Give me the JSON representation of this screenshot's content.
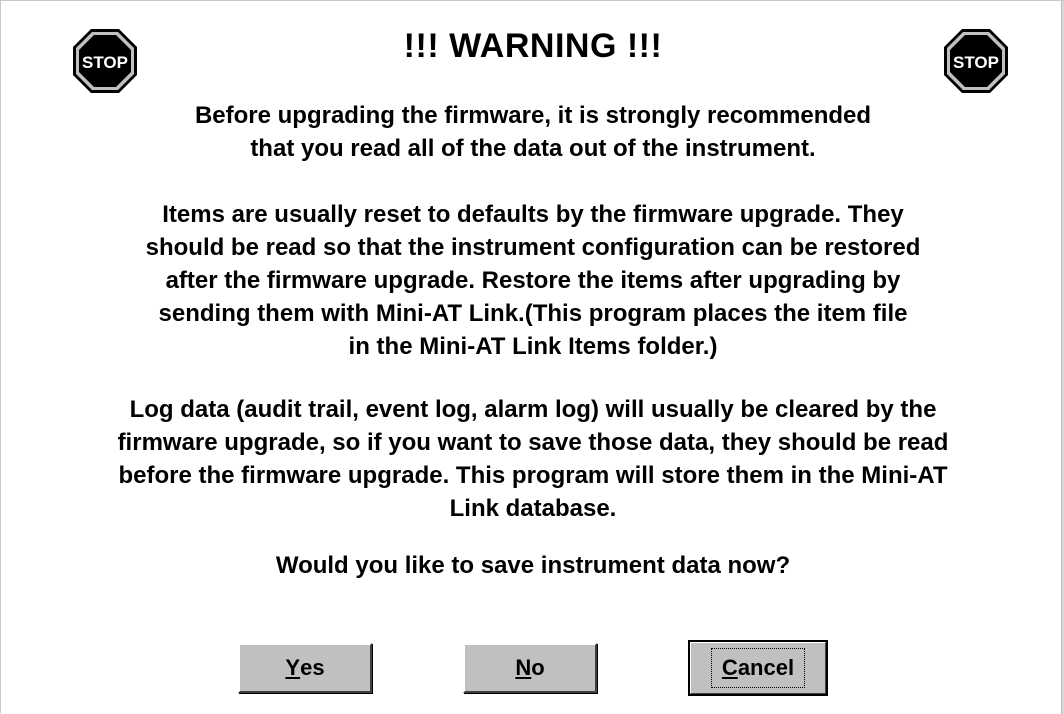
{
  "dialog": {
    "title": "!!! WARNING !!!",
    "icons": {
      "left": "stop-sign-icon",
      "right": "stop-sign-icon",
      "icon_text": "STOP",
      "icon_color": "#c0c0c0"
    },
    "paragraph1": [
      "Before upgrading the firmware, it is strongly recommended",
      "that you read all of the data out of the instrument."
    ],
    "paragraph2": [
      "Items are usually reset to defaults by the firmware upgrade. They",
      "should be read so that the instrument configuration can be restored",
      "after the firmware upgrade. Restore the items after upgrading by",
      "sending them with Mini-AT Link.(This program places the item file",
      "in the Mini-AT Link Items folder.)"
    ],
    "paragraph3": [
      "Log data (audit trail, event log, alarm log) will usually be cleared by the",
      "firmware upgrade, so if you want to save those data, they should be read",
      "before the firmware upgrade. This program will store them in the Mini-AT",
      "Link database."
    ],
    "question": "Would you like to save instrument data now?",
    "buttons": {
      "yes": {
        "mnemonic": "Y",
        "rest": "es"
      },
      "no": {
        "mnemonic": "N",
        "rest": "o"
      },
      "cancel": {
        "mnemonic": "C",
        "rest": "ancel"
      }
    }
  }
}
